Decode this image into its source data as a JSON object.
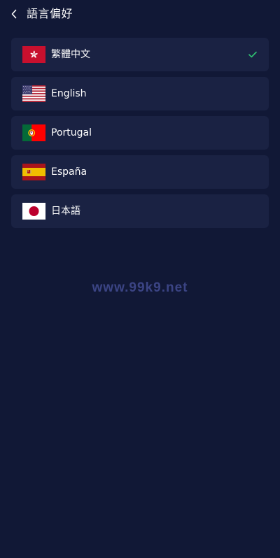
{
  "header": {
    "title": "語言偏好",
    "back_icon": "chevron-left-icon"
  },
  "languages": [
    {
      "label": "繁體中文",
      "flag_icon": "hong-kong-flag-icon",
      "selected": true
    },
    {
      "label": "English",
      "flag_icon": "us-flag-icon",
      "selected": false
    },
    {
      "label": "Portugal",
      "flag_icon": "portugal-flag-icon",
      "selected": false
    },
    {
      "label": "España",
      "flag_icon": "spain-flag-icon",
      "selected": false
    },
    {
      "label": "日本語",
      "flag_icon": "japan-flag-icon",
      "selected": false
    }
  ],
  "watermark": "www.99k9.net",
  "colors": {
    "background": "#111836",
    "item_background": "#1a2243",
    "check": "#2fbf71",
    "watermark": "#3b4484"
  }
}
